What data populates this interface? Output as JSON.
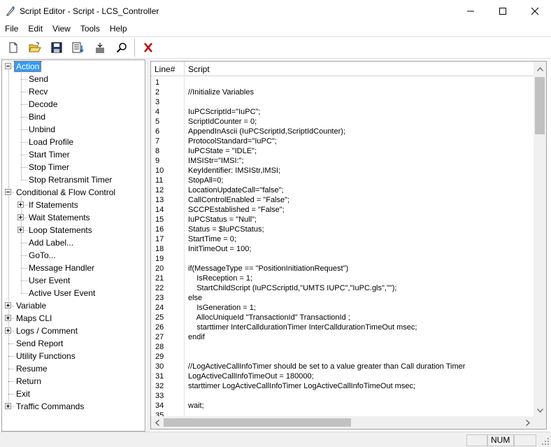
{
  "window": {
    "title": "Script Editor - Script - LCS_Controller",
    "app_icon": "script-pen-icon",
    "controls": [
      "minimize-icon",
      "maximize-icon",
      "close-icon"
    ]
  },
  "menu": [
    "File",
    "Edit",
    "View",
    "Tools",
    "Help"
  ],
  "toolbar": {
    "buttons": [
      "new-file-icon",
      "open-folder-icon",
      "save-icon",
      "import-list-icon",
      "insert-lines-icon",
      "search-icon",
      "delete-x-icon"
    ]
  },
  "tree": {
    "items": [
      {
        "label": "Action",
        "level": 0,
        "expander": "minus",
        "selected": true
      },
      {
        "label": "Send",
        "level": 1
      },
      {
        "label": "Recv",
        "level": 1
      },
      {
        "label": "Decode",
        "level": 1
      },
      {
        "label": "Bind",
        "level": 1
      },
      {
        "label": "Unbind",
        "level": 1
      },
      {
        "label": "Load Profile",
        "level": 1
      },
      {
        "label": "Start Timer",
        "level": 1
      },
      {
        "label": "Stop Timer",
        "level": 1
      },
      {
        "label": "Stop Retransmit Timer",
        "level": 1
      },
      {
        "label": "Conditional & Flow Control",
        "level": 0,
        "expander": "minus"
      },
      {
        "label": "If Statements",
        "level": 1,
        "expander": "plus"
      },
      {
        "label": "Wait Statements",
        "level": 1,
        "expander": "plus"
      },
      {
        "label": "Loop Statements",
        "level": 1,
        "expander": "plus"
      },
      {
        "label": "Add Label...",
        "level": 1
      },
      {
        "label": "GoTo...",
        "level": 1
      },
      {
        "label": "Message Handler",
        "level": 1
      },
      {
        "label": "User Event",
        "level": 1
      },
      {
        "label": "Active User Event",
        "level": 1
      },
      {
        "label": "Variable",
        "level": 0,
        "expander": "plus"
      },
      {
        "label": "Maps CLI",
        "level": 0,
        "expander": "plus"
      },
      {
        "label": "Logs / Comment",
        "level": 0,
        "expander": "plus"
      },
      {
        "label": "Send Report",
        "level": 0
      },
      {
        "label": "Utility Functions",
        "level": 0
      },
      {
        "label": "Resume",
        "level": 0
      },
      {
        "label": "Return",
        "level": 0
      },
      {
        "label": "Exit",
        "level": 0
      },
      {
        "label": "Traffic Commands",
        "level": 0,
        "expander": "plus"
      }
    ]
  },
  "grid": {
    "columns": [
      "Line#",
      "Script"
    ],
    "rows": [
      {
        "num": "1",
        "text": ""
      },
      {
        "num": "2",
        "text": "//Initialize Variables"
      },
      {
        "num": "3",
        "text": ""
      },
      {
        "num": "4",
        "text": "IuPCScriptId=\"IuPC\";"
      },
      {
        "num": "5",
        "text": "ScriptIdCounter = 0;"
      },
      {
        "num": "6",
        "text": "AppendInAscii (IuPCScriptId,ScriptIdCounter);"
      },
      {
        "num": "7",
        "text": "ProtocolStandard=\"IuPC\";"
      },
      {
        "num": "8",
        "text": "IuPCState = \"IDLE\";"
      },
      {
        "num": "9",
        "text": "IMSIStr=\"IMSI:\";"
      },
      {
        "num": "10",
        "text": "KeyIdentifier: IMSIStr,IMSI;"
      },
      {
        "num": "11",
        "text": "StopAll=0;"
      },
      {
        "num": "12",
        "text": "LocationUpdateCall=\"false\";"
      },
      {
        "num": "13",
        "text": "CallControlEnabled = \"False\";"
      },
      {
        "num": "14",
        "text": "SCCPEstablished = \"False\";"
      },
      {
        "num": "15",
        "text": "IuPCStatus = \"Null\";"
      },
      {
        "num": "16",
        "text": "Status = $IuPCStatus;"
      },
      {
        "num": "17",
        "text": "StartTime = 0;"
      },
      {
        "num": "18",
        "text": "InitTimeOut = 100;"
      },
      {
        "num": "19",
        "text": ""
      },
      {
        "num": "20",
        "text": "if(MessageType == \"PositionInitiationRequest\")"
      },
      {
        "num": "21",
        "text": "    IsReception = 1;"
      },
      {
        "num": "22",
        "text": "    StartChildScript (IuPCScriptId,\"UMTS IUPC\",\"IuPC.gls\",\"\");"
      },
      {
        "num": "23",
        "text": "else"
      },
      {
        "num": "24",
        "text": "    IsGeneration = 1;"
      },
      {
        "num": "25",
        "text": "    AllocUniqueId \"TransactionId\" TransactionId ;"
      },
      {
        "num": "26",
        "text": "    starttimer InterCalldurationTimer InterCalldurationTimeOut msec;"
      },
      {
        "num": "27",
        "text": "endif"
      },
      {
        "num": "28",
        "text": ""
      },
      {
        "num": "29",
        "text": ""
      },
      {
        "num": "30",
        "text": "//LogActiveCallInfoTimer should be set to a value greater than Call duration Timer"
      },
      {
        "num": "31",
        "text": "LogActiveCallInfoTimeOut = 180000;"
      },
      {
        "num": "32",
        "text": "starttimer LogActiveCallInfoTimer LogActiveCallInfoTimeOut msec;"
      },
      {
        "num": "33",
        "text": ""
      },
      {
        "num": "34",
        "text": "wait;"
      },
      {
        "num": "35",
        "text": ""
      }
    ]
  },
  "statusbar": {
    "panels": [
      "",
      "NUM",
      ""
    ]
  }
}
